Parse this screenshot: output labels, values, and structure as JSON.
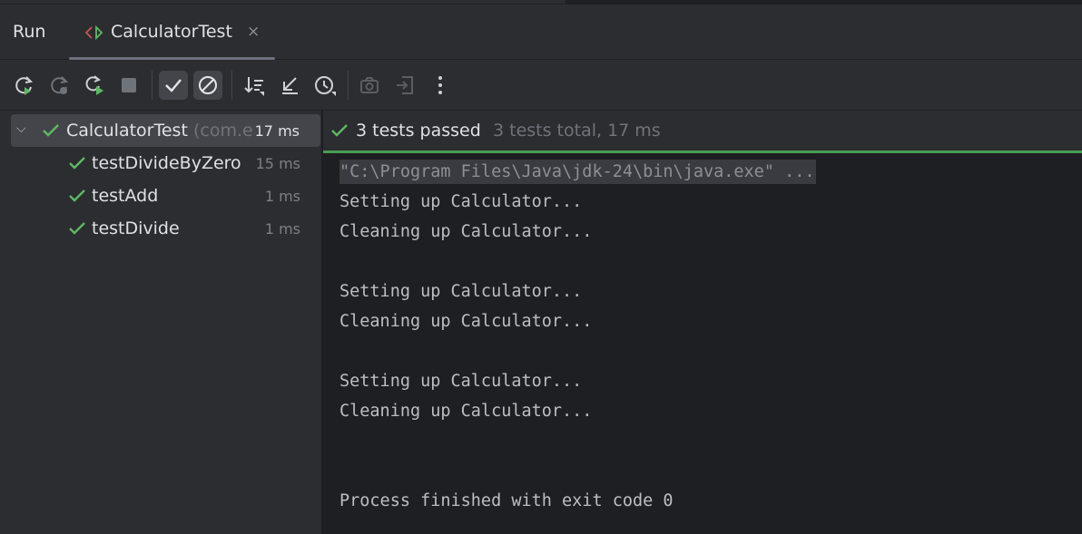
{
  "header": {
    "run_label": "Run",
    "tab_title": "CalculatorTest",
    "close_glyph": "×"
  },
  "toolbar": {
    "buttons": [
      "rerun-icon",
      "rerun-failed-icon",
      "toggle-auto-test-icon",
      "stop-icon",
      "show-passed-icon",
      "show-ignored-icon",
      "sort-icon",
      "collapse-icon",
      "history-icon",
      "screenshot-icon",
      "export-icon",
      "more-icon"
    ]
  },
  "tree": {
    "root": {
      "name": "CalculatorTest",
      "package": "(com.e:",
      "time": "17 ms"
    },
    "children": [
      {
        "name": "testDivideByZero",
        "time": "15 ms"
      },
      {
        "name": "testAdd",
        "time": "1 ms"
      },
      {
        "name": "testDivide",
        "time": "1 ms"
      }
    ]
  },
  "status": {
    "passed": "3 tests passed",
    "total": "3 tests total, 17 ms"
  },
  "console": {
    "command": "\"C:\\Program Files\\Java\\jdk-24\\bin\\java.exe\" ...",
    "lines": [
      "Setting up Calculator...",
      "Cleaning up Calculator...",
      "",
      "Setting up Calculator...",
      "Cleaning up Calculator...",
      "",
      "Setting up Calculator...",
      "Cleaning up Calculator...",
      "",
      ""
    ],
    "exit": "Process finished with exit code 0"
  },
  "colors": {
    "success": "#5fb865",
    "progress_bar": "#499c54",
    "panel_bg": "#2b2d30",
    "console_bg": "#1e1f22"
  }
}
